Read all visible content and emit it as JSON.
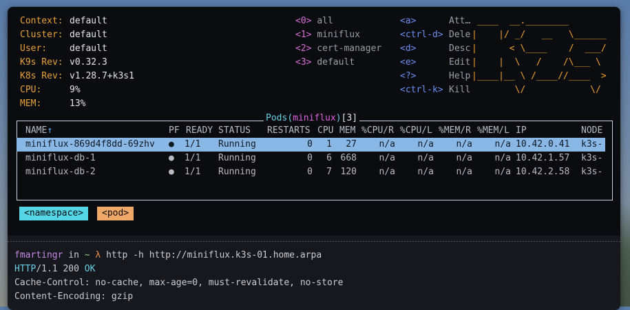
{
  "info": [
    {
      "label": "Context:",
      "value": "default"
    },
    {
      "label": "Cluster:",
      "value": "default"
    },
    {
      "label": "User:",
      "value": "default"
    },
    {
      "label": "K9s Rev:",
      "value": "v0.32.3"
    },
    {
      "label": "K8s Rev:",
      "value": "v1.28.7+k3s1"
    },
    {
      "label": "CPU:",
      "value": "9%"
    },
    {
      "label": "MEM:",
      "value": "13%"
    }
  ],
  "namespaces": [
    {
      "num": "<0>",
      "name": "all"
    },
    {
      "num": "<1>",
      "name": "miniflux"
    },
    {
      "num": "<2>",
      "name": "cert-manager"
    },
    {
      "num": "<3>",
      "name": "default"
    }
  ],
  "shortcuts": [
    {
      "key": "<a>",
      "action": "Att…"
    },
    {
      "key": "<ctrl-d>",
      "action": "Dele"
    },
    {
      "key": "<d>",
      "action": "Desc"
    },
    {
      "key": "<e>",
      "action": "Edit"
    },
    {
      "key": "<?>",
      "action": "Help"
    },
    {
      "key": "<ctrl-k>",
      "action": "Kill"
    }
  ],
  "logo": [
    " ____  __.________",
    "|    |/ _/   __   \\______",
    "|      < \\____    /  ___/",
    "|    |  \\   /    /\\___ \\",
    "|____|__ \\ /____//____  >",
    "        \\/            \\/"
  ],
  "table": {
    "title_word": "Pods",
    "title_open": "(",
    "title_ns": "miniflux",
    "title_close": ")",
    "title_count": "[3]",
    "headers": {
      "name": "NAME",
      "sort_arrow": "↑",
      "pf": "PF",
      "ready": "READY",
      "status": "STATUS",
      "restarts": "RESTARTS",
      "cpu": "CPU",
      "mem": "MEM",
      "cpu_r": "%CPU/R",
      "cpu_l": "%CPU/L",
      "mem_r": "%MEM/R",
      "mem_l": "%MEM/L",
      "ip": "IP",
      "node": "NODE"
    },
    "rows": [
      {
        "name": "miniflux-869d4f8dd-69zhv",
        "pf": "●",
        "ready": "1/1",
        "status": "Running",
        "restarts": "0",
        "cpu": "1",
        "mem": "27",
        "cpu_r": "n/a",
        "cpu_l": "n/a",
        "mem_r": "n/a",
        "mem_l": "n/a",
        "ip": "10.42.0.41",
        "node": "k3s-"
      },
      {
        "name": "miniflux-db-1",
        "pf": "●",
        "ready": "1/1",
        "status": "Running",
        "restarts": "0",
        "cpu": "6",
        "mem": "668",
        "cpu_r": "n/a",
        "cpu_l": "n/a",
        "mem_r": "n/a",
        "mem_l": "n/a",
        "ip": "10.42.1.57",
        "node": "k3s-"
      },
      {
        "name": "miniflux-db-2",
        "pf": "●",
        "ready": "1/1",
        "status": "Running",
        "restarts": "0",
        "cpu": "7",
        "mem": "120",
        "cpu_r": "n/a",
        "cpu_l": "n/a",
        "mem_r": "n/a",
        "mem_l": "n/a",
        "ip": "10.42.2.58",
        "node": "k3s-"
      }
    ]
  },
  "crumbs": [
    "<namespace>",
    "<pod>"
  ],
  "shell": {
    "user": "fmartingr",
    "in": "in",
    "dir": "~",
    "prompt": "λ",
    "command": "http -h http://miniflux.k3s-01.home.arpa",
    "status_proto": "HTTP",
    "status_rest": "/1.1 200 ",
    "status_ok": "OK",
    "headers": [
      {
        "name": "Cache-Control",
        "value": "no-cache, max-age=0, must-revalidate, no-store"
      },
      {
        "name": "Content-Encoding",
        "value": "gzip"
      }
    ]
  }
}
